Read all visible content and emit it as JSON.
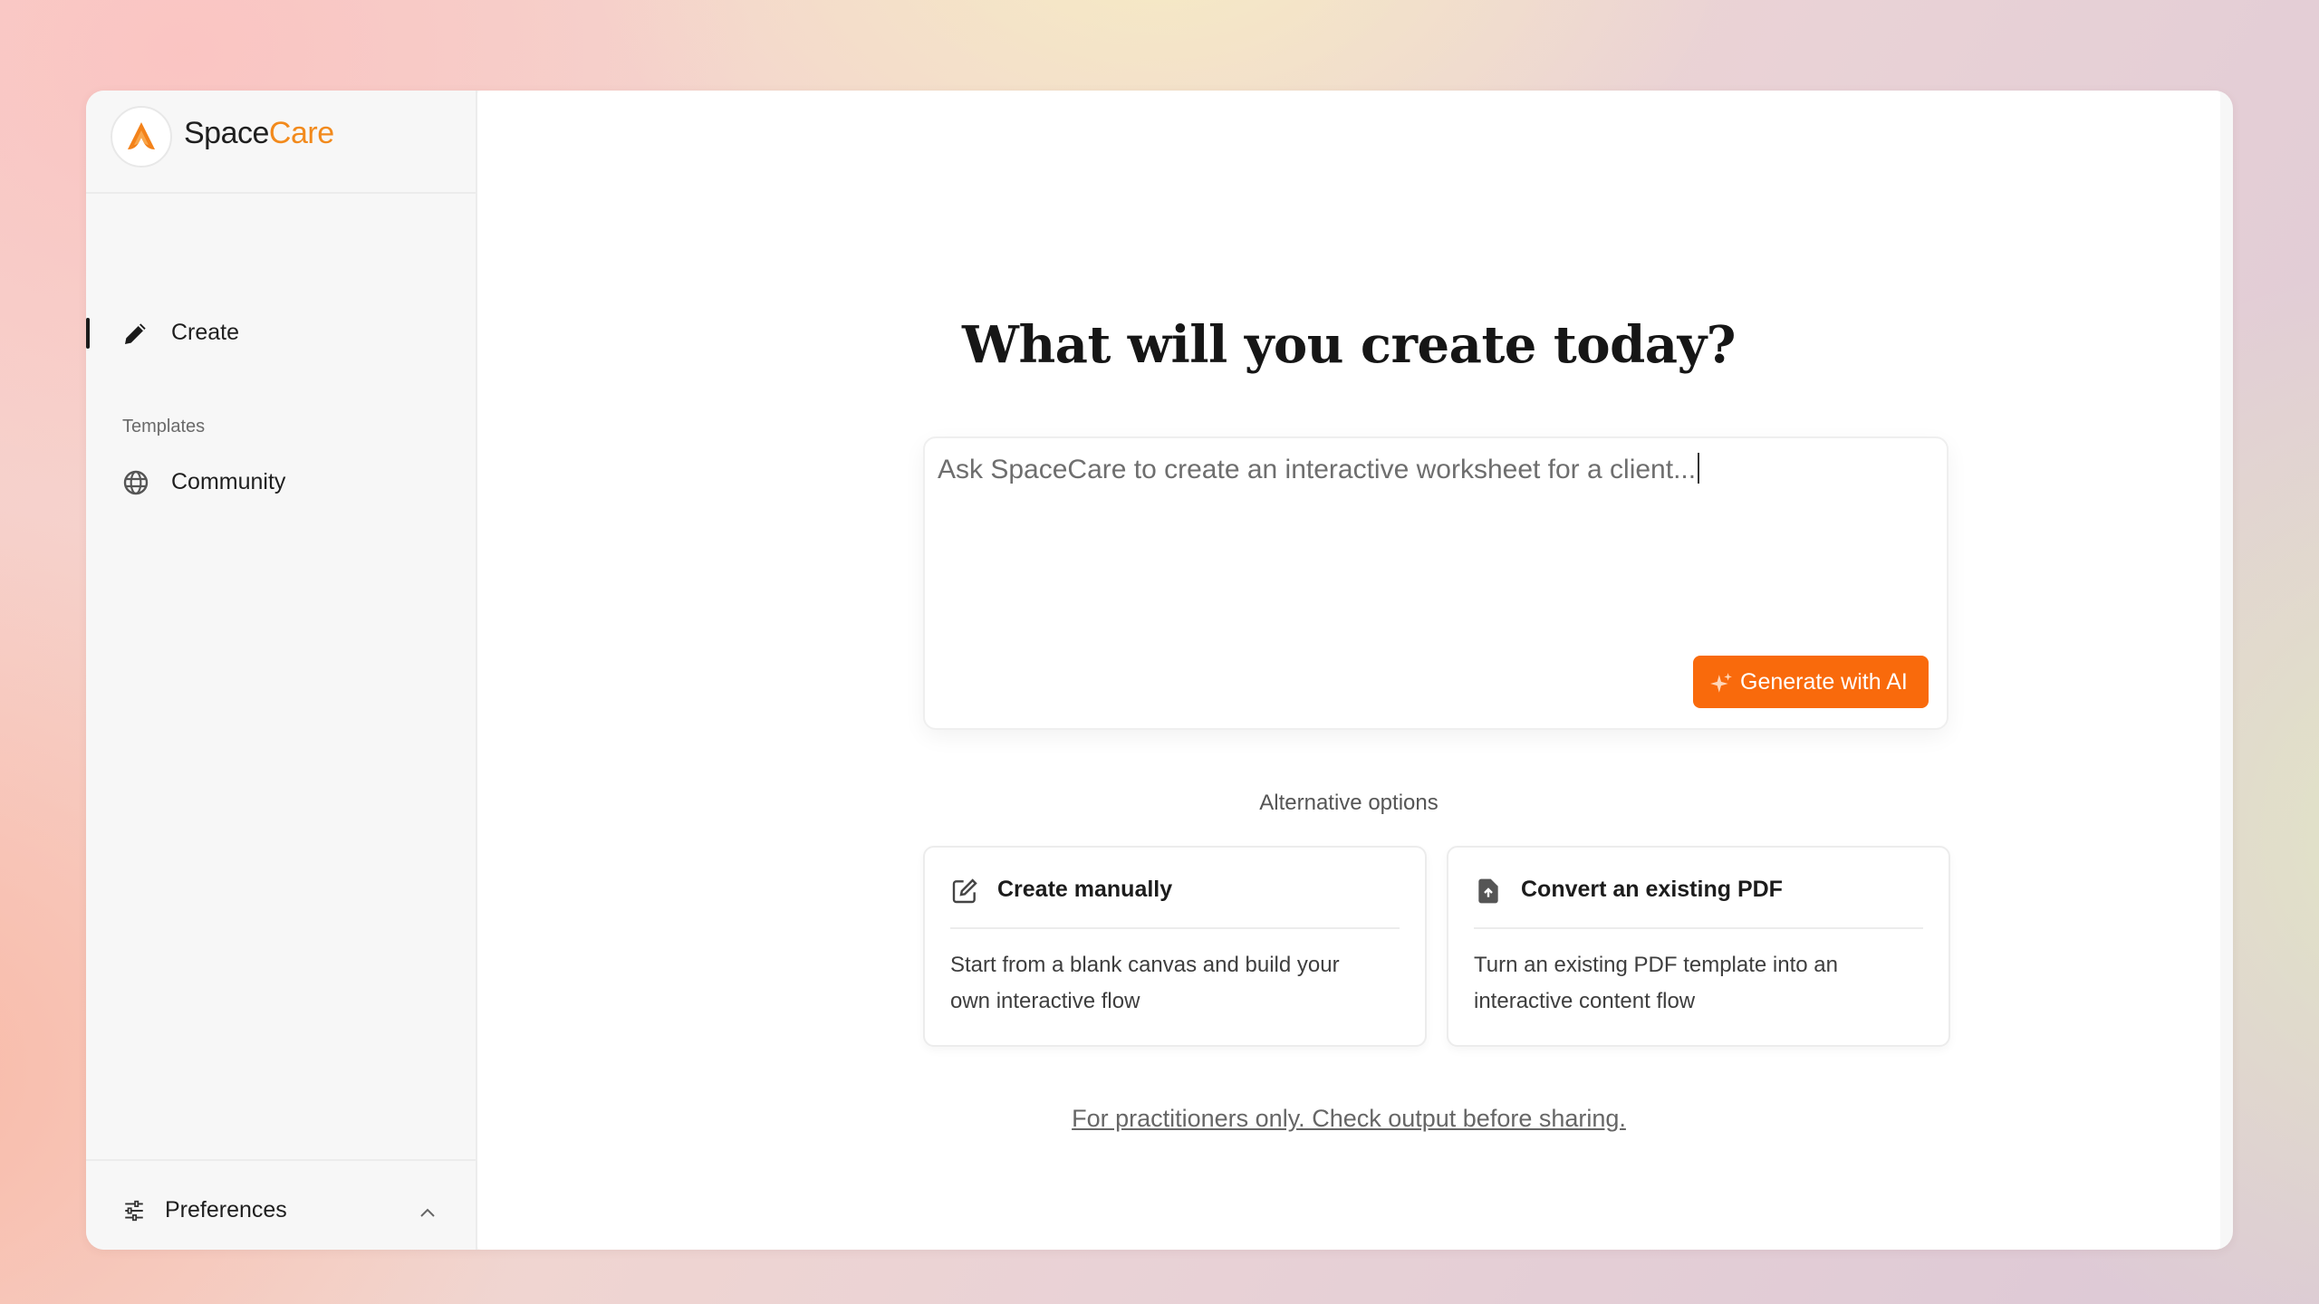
{
  "brand": {
    "name_prefix": "Space",
    "name_accent": "Care",
    "accent_color": "#f28a1c"
  },
  "sidebar": {
    "create_label": "Create",
    "section_label": "Templates",
    "community_label": "Community",
    "preferences_label": "Preferences",
    "icons": {
      "create": "pencil-icon",
      "community": "globe-icon",
      "preferences": "sliders-icon",
      "preferences_toggle": "chevron-up-icon"
    }
  },
  "main": {
    "headline": "What will you create today?",
    "prompt": {
      "placeholder": "Ask SpaceCare to create an interactive worksheet for a client..."
    },
    "generate_button": {
      "label": "Generate with AI",
      "icon": "sparkle-icon",
      "color": "#f96a0c"
    },
    "alternatives_label": "Alternative options",
    "options": [
      {
        "title": "Create manually",
        "description": "Start from a blank canvas and build your own interactive flow",
        "icon": "edit-square-icon"
      },
      {
        "title": "Convert an existing PDF",
        "description": "Turn an existing PDF template into an interactive content flow",
        "icon": "file-upload-icon"
      }
    ],
    "disclaimer": "For practitioners only. Check output before sharing."
  }
}
